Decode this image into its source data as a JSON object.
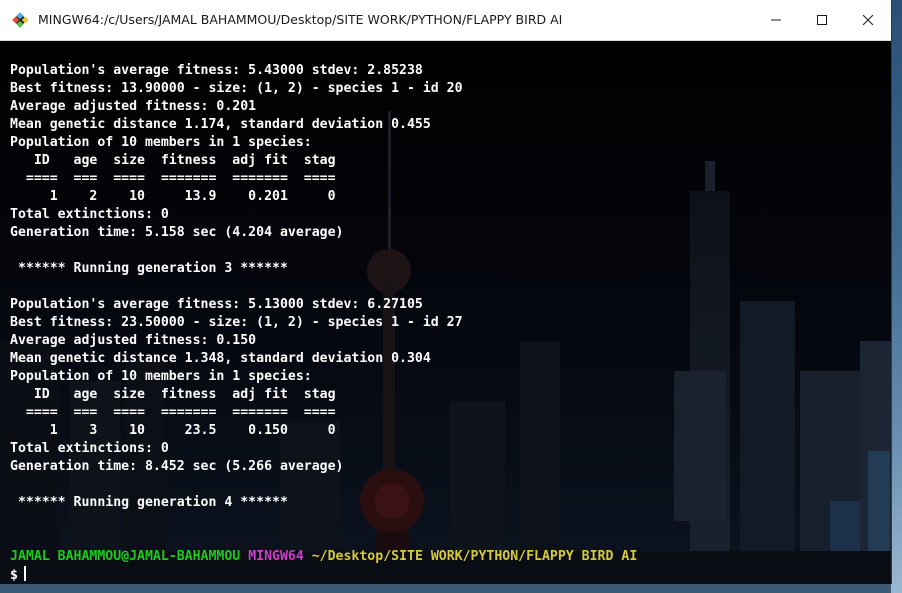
{
  "window": {
    "title": "MINGW64:/c/Users/JAMAL BAHAMMOU/Desktop/SITE WORK/PYTHON/FLAPPY BIRD AI",
    "controls": {
      "minimize_icon": "minimize-icon",
      "maximize_icon": "maximize-icon",
      "close_icon": "close-icon"
    }
  },
  "colors": {
    "user": "#1fc91f",
    "system": "#c93fc9",
    "path": "#d8c83a",
    "text": "#ffffff",
    "background": "#000000"
  },
  "terminal": {
    "lines": [
      "Population's average fitness: 5.43000 stdev: 2.85238",
      "Best fitness: 13.90000 - size: (1, 2) - species 1 - id 20",
      "Average adjusted fitness: 0.201",
      "Mean genetic distance 1.174, standard deviation 0.455",
      "Population of 10 members in 1 species:",
      "   ID   age  size  fitness  adj fit  stag",
      "  ====  ===  ====  =======  =======  ====",
      "     1    2    10     13.9    0.201     0",
      "Total extinctions: 0",
      "Generation time: 5.158 sec (4.204 average)",
      "",
      " ****** Running generation 3 ******",
      "",
      "Population's average fitness: 5.13000 stdev: 6.27105",
      "Best fitness: 23.50000 - size: (1, 2) - species 1 - id 27",
      "Average adjusted fitness: 0.150",
      "Mean genetic distance 1.348, standard deviation 0.304",
      "Population of 10 members in 1 species:",
      "   ID   age  size  fitness  adj fit  stag",
      "  ====  ===  ====  =======  =======  ====",
      "     1    3    10     23.5    0.150     0",
      "Total extinctions: 0",
      "Generation time: 8.452 sec (5.266 average)",
      "",
      " ****** Running generation 4 ******",
      "",
      ""
    ],
    "prompt": {
      "user_host": "JAMAL BAHAMMOU@JAMAL-BAHAMMOU",
      "system": "MINGW64",
      "path": "~/Desktop/SITE WORK/PYTHON/FLAPPY BIRD AI",
      "symbol": "$"
    }
  }
}
